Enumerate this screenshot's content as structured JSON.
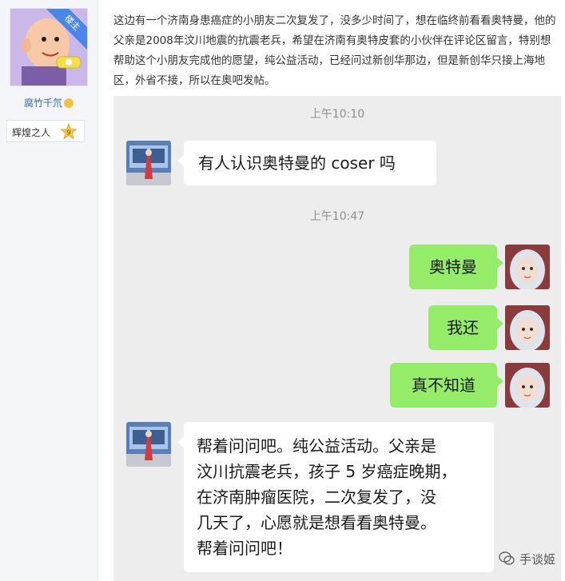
{
  "sidebar": {
    "ribbon_label": "楼主",
    "username": "腐竹千氘",
    "badge_name": "辉煌之人",
    "badge_level": "9"
  },
  "post": {
    "text": "这边有一个济南身患癌症的小朋友二次复发了，没多少时间了，想在临终前看看奥特曼，他的父亲是2008年汶川地震的抗震老兵，希望在济南有奥特皮套的小伙伴在评论区留言，特别想帮助这个小朋友完成他的愿望，纯公益活动，已经问过新创华那边，但是新创华只接上海地区，外省不接，所以在奥吧发帖。"
  },
  "chat": {
    "time1": "上午10:10",
    "msg1": "有人认识奥特曼的 coser 吗",
    "time2": "上午10:47",
    "msg2": "奥特曼",
    "msg3": "我还",
    "msg4": "真不知道",
    "msg5_lines": [
      "帮着问问吧。纯公益活动。父亲是",
      "汶川抗震老兵，孩子 5 岁癌症晚期，",
      "在济南肿瘤医院，二次复发了，没",
      "几天了，心愿就是想看看奥特曼。",
      "帮着问问吧！"
    ]
  },
  "watermark": {
    "label": "手谈姬"
  },
  "colors": {
    "bubble_green": "#95ec69",
    "chat_bg": "#ededed",
    "link_blue": "#2d64b3"
  }
}
